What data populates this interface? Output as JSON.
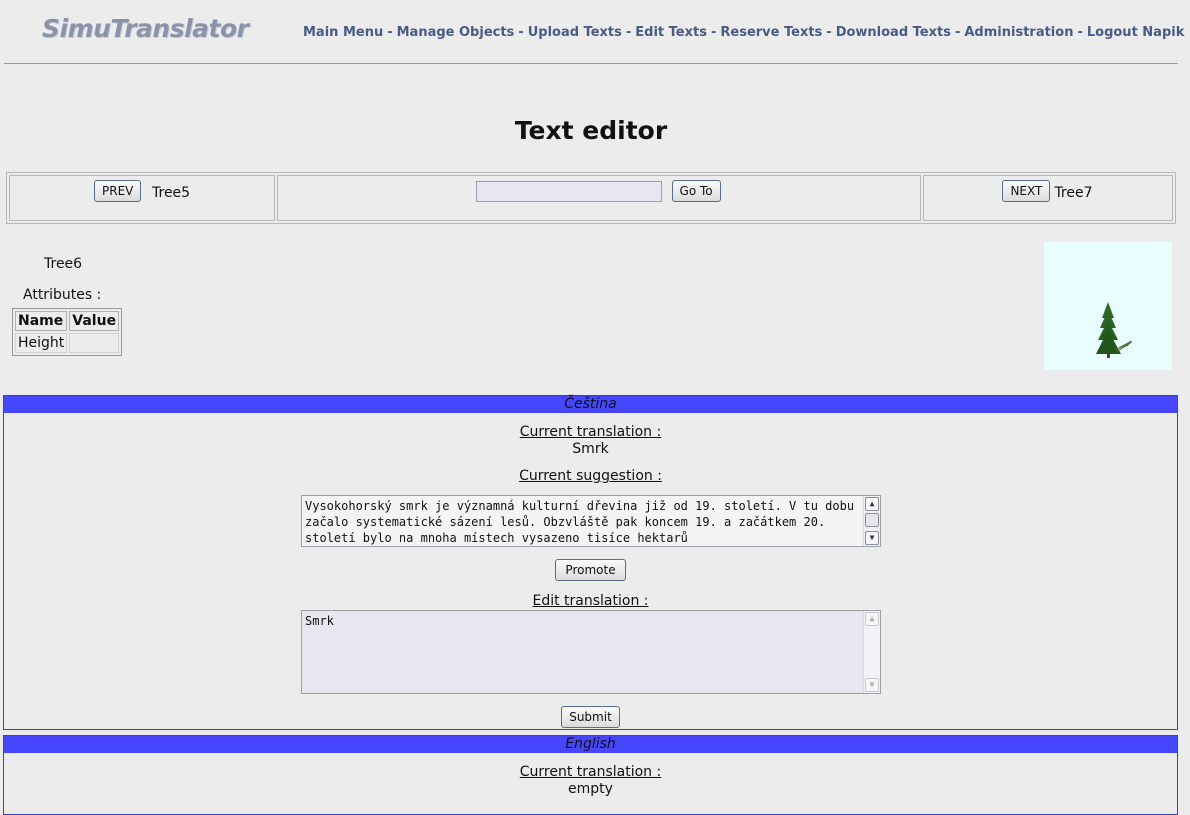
{
  "app": {
    "logo_text": "SimuTranslator"
  },
  "nav": {
    "items": [
      "Main Menu",
      "Manage Objects",
      "Upload Texts",
      "Edit Texts",
      "Reserve Texts",
      "Download Texts",
      "Administration",
      "Logout Napik"
    ],
    "separator": "-"
  },
  "page": {
    "title": "Text editor"
  },
  "navigation_bar": {
    "prev_button": "PREV",
    "prev_item": "Tree5",
    "goto_value": "",
    "goto_button": "Go To",
    "next_button": "NEXT",
    "next_item": "Tree7"
  },
  "object": {
    "name": "Tree6",
    "attributes_title": "Attributes :",
    "columns": [
      "Name",
      "Value"
    ],
    "rows": [
      [
        "Height",
        ""
      ]
    ],
    "preview_icon": "tree-icon"
  },
  "languages": [
    {
      "name": "Čeština",
      "current_translation_label": "Current translation :",
      "current_translation": "Smrk",
      "current_suggestion_label": "Current suggestion :",
      "suggestion_text": "Vysokohorský smrk je významná kulturní dřevina již od 19. století. V tu dobu začalo systematické sázení lesů. Obzvláště pak koncem 19. a začátkem 20. století bylo na mnoha místech vysazeno tisíce hektarů",
      "promote_button": "Promote",
      "edit_translation_label": "Edit translation :",
      "edit_value": "Smrk",
      "submit_button": "Submit"
    },
    {
      "name": "English",
      "current_translation_label": "Current translation :",
      "current_translation": "empty"
    }
  ],
  "colors": {
    "nav_link": "#4a5a86",
    "logo": "#8a93aa",
    "lang_header": "#4646ff",
    "background": "#ececec"
  }
}
